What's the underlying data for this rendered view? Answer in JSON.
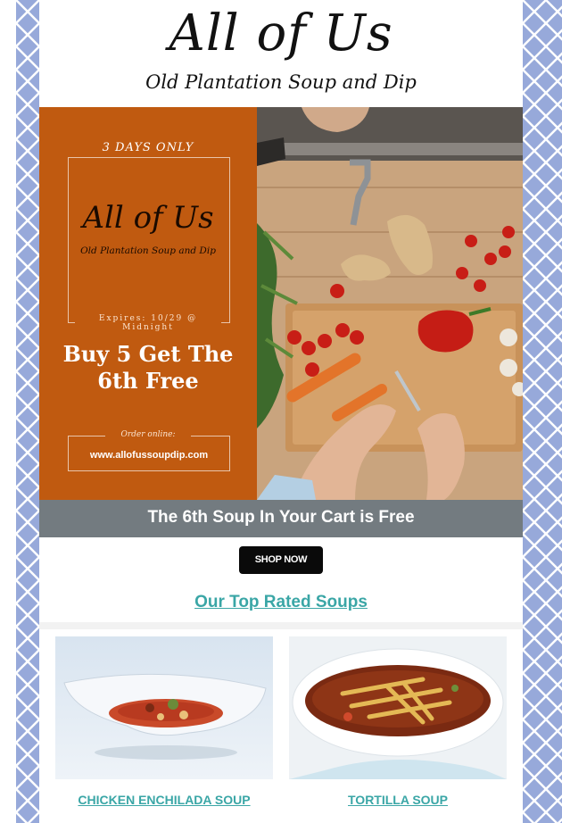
{
  "brand": {
    "title": "All of Us",
    "subtitle": "Old Plantation Soup and Dip"
  },
  "promo": {
    "days": "3 DAYS ONLY",
    "brand_title": "All of Us",
    "brand_subtitle": "Old Plantation Soup and Dip",
    "expires": "Expires: 10/29 @ Midnight",
    "offer": "Buy 5 Get The 6th Free",
    "order_label": "Order online:",
    "url": "www.allofussoupdip.com"
  },
  "band": {
    "text": "The 6th Soup In Your Cart is Free"
  },
  "cta": {
    "label": "SHOP NOW"
  },
  "section": {
    "title": "Our Top Rated Soups"
  },
  "products": [
    {
      "name": "CHICKEN ENCHILADA SOUP"
    },
    {
      "name": "TORTILLA SOUP"
    }
  ],
  "colors": {
    "promo_bg": "#c05a10",
    "band_bg": "#737b80",
    "link": "#3aa6a6",
    "frame_pattern": "#97a9da"
  }
}
